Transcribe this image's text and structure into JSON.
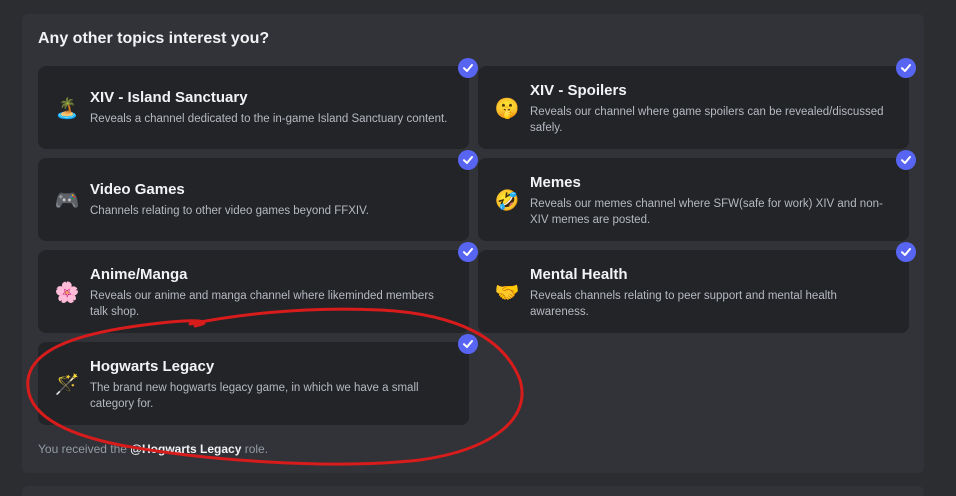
{
  "section": {
    "title": "Any other topics interest you?"
  },
  "cards": [
    {
      "emoji": "🏝️",
      "emoji_name": "island-icon",
      "title": "XIV - Island Sanctuary",
      "desc": "Reveals a channel dedicated to the in-game Island Sanctuary content.",
      "checked": true
    },
    {
      "emoji": "🤫",
      "emoji_name": "shushing-face-icon",
      "title": "XIV - Spoilers",
      "desc": "Reveals our channel where game spoilers can be revealed/discussed safely.",
      "checked": true
    },
    {
      "emoji": "🎮",
      "emoji_name": "game-controller-icon",
      "title": "Video Games",
      "desc": "Channels relating to other video games beyond FFXIV.",
      "checked": true
    },
    {
      "emoji": "🤣",
      "emoji_name": "laughing-face-icon",
      "title": "Memes",
      "desc": "Reveals our memes channel where SFW(safe for work) XIV and non-XIV memes are posted.",
      "checked": true
    },
    {
      "emoji": "🌸",
      "emoji_name": "anime-character-icon",
      "title": "Anime/Manga",
      "desc": "Reveals our anime and manga channel where likeminded members talk shop.",
      "checked": true
    },
    {
      "emoji": "🤝",
      "emoji_name": "handshake-icon",
      "title": "Mental Health",
      "desc": "Reveals channels relating to peer support and mental health awareness.",
      "checked": true
    },
    {
      "emoji": "🪄",
      "emoji_name": "magic-wand-icon",
      "title": "Hogwarts Legacy",
      "desc": "The brand new hogwarts legacy game, in which we have a small category for.",
      "checked": true
    }
  ],
  "footer": {
    "prefix": "You received the ",
    "role": "@Hogwarts Legacy",
    "suffix": " role."
  },
  "colors": {
    "background": "#2b2d31",
    "panel": "#313338",
    "card": "#232428",
    "accent": "#5865f2",
    "annotation": "#e01818"
  }
}
